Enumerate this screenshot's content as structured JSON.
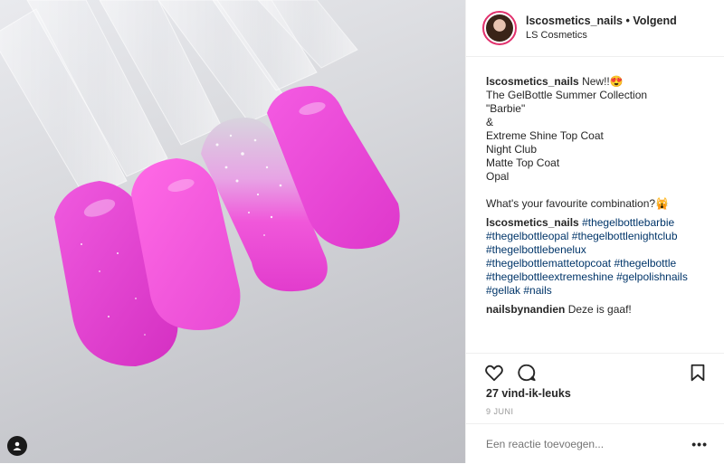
{
  "post": {
    "image_alt": "Five pink gel nail swatches on clear tips",
    "username": "lscosmetics_nails",
    "separator": "•",
    "follow_label": "Volgend",
    "location": "LS Cosmetics",
    "caption": {
      "username": "lscosmetics_nails",
      "lines": [
        "New!!😍",
        "The GelBottle Summer Collection",
        "\"Barbie\"",
        "&",
        "Extreme Shine Top Coat",
        "Night Club",
        "Matte Top Coat",
        "Opal",
        "",
        "What's your favourite combination?🙀"
      ]
    },
    "hashtag_comment": {
      "username": "lscosmetics_nails",
      "tags": [
        "#thegelbottlebarbie",
        "#thegelbottleopal",
        "#thegelbottlenightclub",
        "#thegelbottlebenelux",
        "#thegelbottlemattetopcoat",
        "#thegelbottle",
        "#thegelbottleextremeshine",
        "#gelpolishnails",
        "#gellak",
        "#nails"
      ]
    },
    "reply": {
      "username": "nailsbynandien",
      "text": "Deze is gaaf!"
    },
    "likes": "27 vind-ik-leuks",
    "date": "9 JUNI",
    "comment_placeholder": "Een reactie toevoegen...",
    "more": "•••"
  },
  "icons": {
    "like": "heart-icon",
    "comment": "comment-bubble-icon",
    "save": "bookmark-icon",
    "tag": "user-tag-icon"
  },
  "colors": {
    "avatar_ring": "#e1306c",
    "hashtag": "#003569",
    "nail_pink": "#e43fd0"
  }
}
